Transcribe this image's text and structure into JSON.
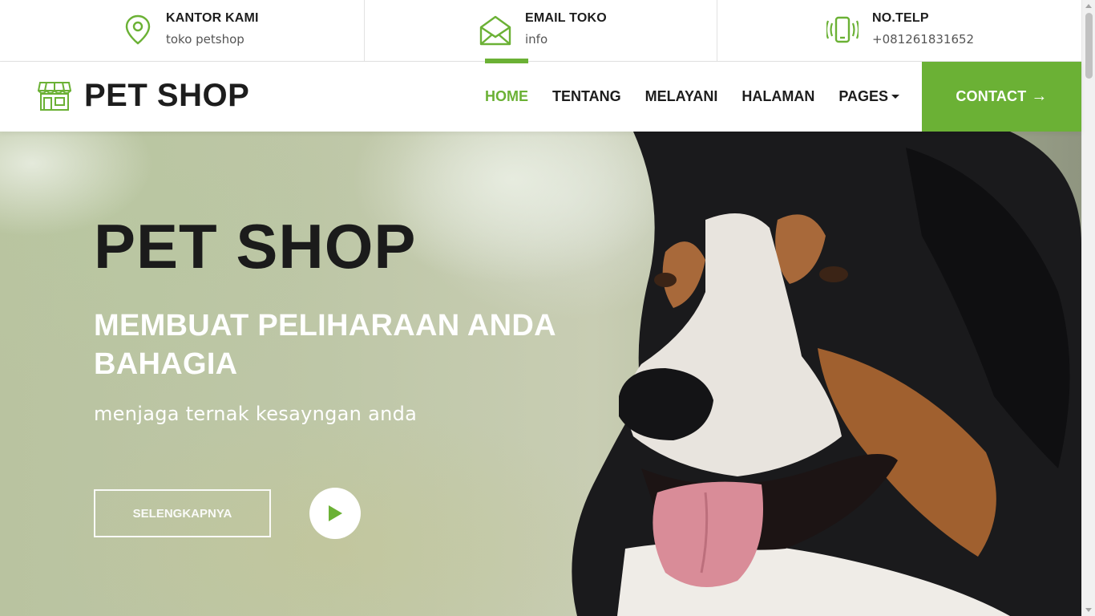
{
  "colors": {
    "accent": "#6bb135",
    "dark": "#1d1d1d",
    "white": "#ffffff"
  },
  "topbar": [
    {
      "icon": "location-pin-icon",
      "title": "KANTOR KAMI",
      "value": "toko petshop"
    },
    {
      "icon": "envelope-icon",
      "title": "EMAIL TOKO",
      "value": "info"
    },
    {
      "icon": "phone-vibrate-icon",
      "title": "NO.TELP",
      "value": "+081261831652"
    }
  ],
  "brand": {
    "icon": "shop-icon",
    "name": "PET SHOP"
  },
  "nav": {
    "items": [
      {
        "label": "HOME",
        "active": true
      },
      {
        "label": "TENTANG"
      },
      {
        "label": "MELAYANI"
      },
      {
        "label": "HALAMAN"
      },
      {
        "label": "PAGES",
        "dropdown": true
      }
    ],
    "contact": {
      "label": "CONTACT",
      "arrow": "→"
    }
  },
  "hero": {
    "title": "PET SHOP",
    "subtitle": "MEMBUAT PELIHARAAN ANDA BAHAGIA",
    "text": "menjaga ternak kesayngan anda",
    "button": "SELENGKAPNYA",
    "play_icon": "play-icon"
  }
}
